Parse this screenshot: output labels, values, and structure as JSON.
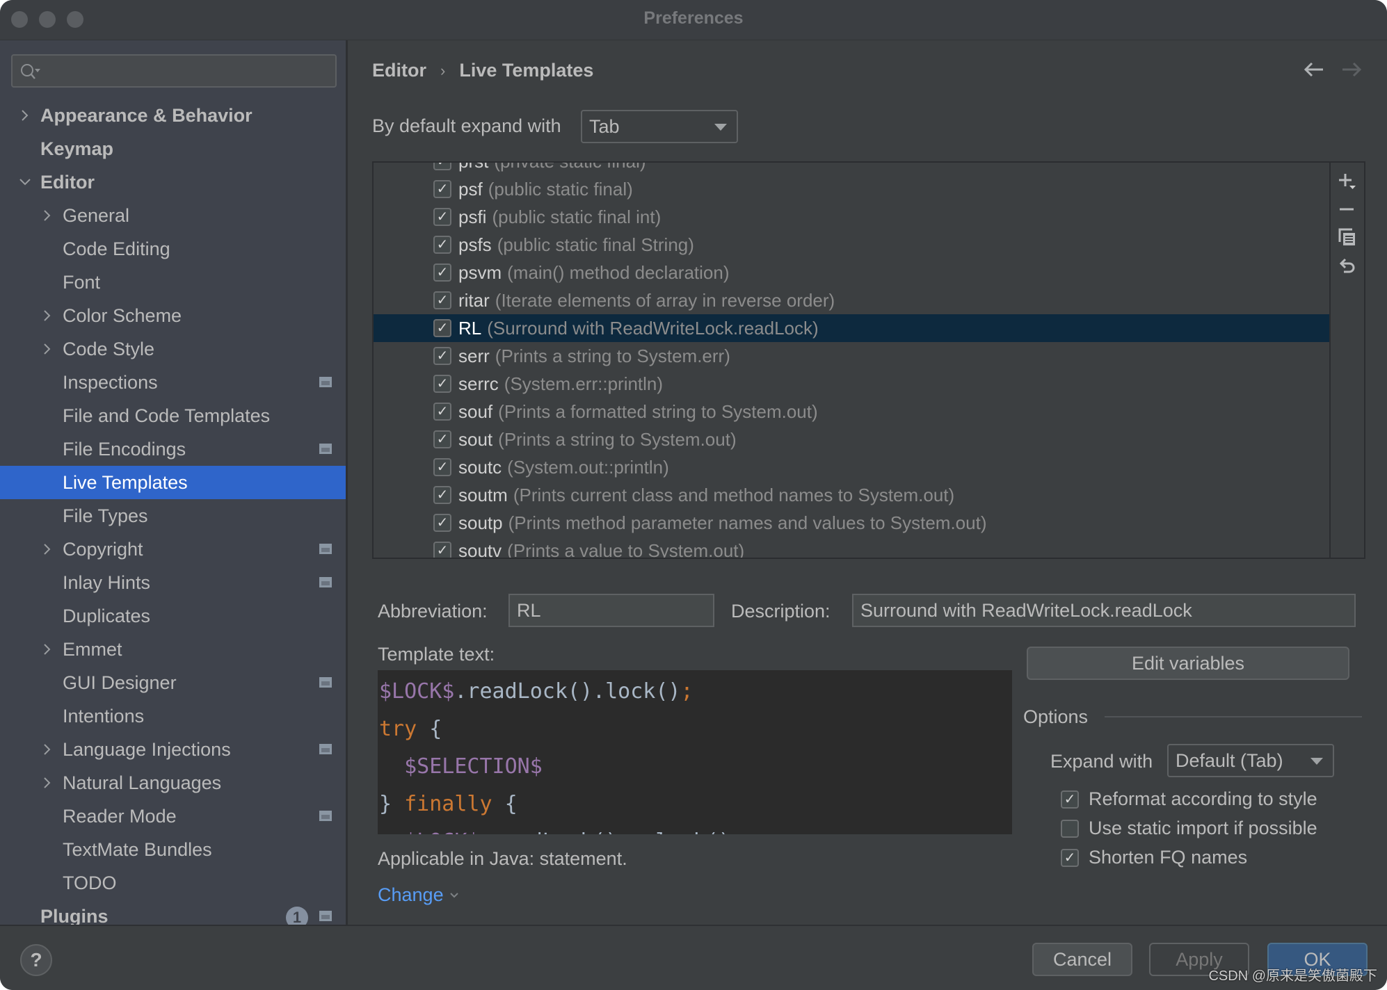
{
  "window": {
    "title": "Preferences"
  },
  "search": {
    "placeholder": "",
    "value": ""
  },
  "sidebar": {
    "items": [
      {
        "label": "Appearance & Behavior",
        "level": 0,
        "arrow": "right",
        "project_icon": false
      },
      {
        "label": "Keymap",
        "level": 0,
        "arrow": "none",
        "project_icon": false
      },
      {
        "label": "Editor",
        "level": 0,
        "arrow": "down",
        "project_icon": false
      },
      {
        "label": "General",
        "level": 1,
        "arrow": "right",
        "project_icon": false
      },
      {
        "label": "Code Editing",
        "level": 1,
        "arrow": "none",
        "project_icon": false
      },
      {
        "label": "Font",
        "level": 1,
        "arrow": "none",
        "project_icon": false
      },
      {
        "label": "Color Scheme",
        "level": 1,
        "arrow": "right",
        "project_icon": false
      },
      {
        "label": "Code Style",
        "level": 1,
        "arrow": "right",
        "project_icon": false
      },
      {
        "label": "Inspections",
        "level": 1,
        "arrow": "none",
        "project_icon": true
      },
      {
        "label": "File and Code Templates",
        "level": 1,
        "arrow": "none",
        "project_icon": false
      },
      {
        "label": "File Encodings",
        "level": 1,
        "arrow": "none",
        "project_icon": true
      },
      {
        "label": "Live Templates",
        "level": 1,
        "arrow": "none",
        "project_icon": false,
        "selected": true
      },
      {
        "label": "File Types",
        "level": 1,
        "arrow": "none",
        "project_icon": false
      },
      {
        "label": "Copyright",
        "level": 1,
        "arrow": "right",
        "project_icon": true
      },
      {
        "label": "Inlay Hints",
        "level": 1,
        "arrow": "none",
        "project_icon": true
      },
      {
        "label": "Duplicates",
        "level": 1,
        "arrow": "none",
        "project_icon": false
      },
      {
        "label": "Emmet",
        "level": 1,
        "arrow": "right",
        "project_icon": false
      },
      {
        "label": "GUI Designer",
        "level": 1,
        "arrow": "none",
        "project_icon": true
      },
      {
        "label": "Intentions",
        "level": 1,
        "arrow": "none",
        "project_icon": false
      },
      {
        "label": "Language Injections",
        "level": 1,
        "arrow": "right",
        "project_icon": true
      },
      {
        "label": "Natural Languages",
        "level": 1,
        "arrow": "right",
        "project_icon": false
      },
      {
        "label": "Reader Mode",
        "level": 1,
        "arrow": "none",
        "project_icon": true
      },
      {
        "label": "TextMate Bundles",
        "level": 1,
        "arrow": "none",
        "project_icon": false
      },
      {
        "label": "TODO",
        "level": 1,
        "arrow": "none",
        "project_icon": false
      },
      {
        "label": "Plugins",
        "level": 0,
        "arrow": "none",
        "project_icon": true,
        "badge": "1"
      }
    ]
  },
  "header": {
    "breadcrumb": [
      "Editor",
      "Live Templates"
    ],
    "separator": "›"
  },
  "expand": {
    "label": "By default expand with",
    "value": "Tab"
  },
  "templates": [
    {
      "abbr": "prst",
      "desc": "(private static final)",
      "checked": true
    },
    {
      "abbr": "psf",
      "desc": "(public static final)",
      "checked": true
    },
    {
      "abbr": "psfi",
      "desc": "(public static final int)",
      "checked": true
    },
    {
      "abbr": "psfs",
      "desc": "(public static final String)",
      "checked": true
    },
    {
      "abbr": "psvm",
      "desc": "(main() method declaration)",
      "checked": true
    },
    {
      "abbr": "ritar",
      "desc": "(Iterate elements of array in reverse order)",
      "checked": true
    },
    {
      "abbr": "RL",
      "desc": "(Surround with ReadWriteLock.readLock)",
      "checked": true,
      "selected": true
    },
    {
      "abbr": "serr",
      "desc": "(Prints a string to System.err)",
      "checked": true
    },
    {
      "abbr": "serrc",
      "desc": "(System.err::println)",
      "checked": true
    },
    {
      "abbr": "souf",
      "desc": "(Prints a formatted string to System.out)",
      "checked": true
    },
    {
      "abbr": "sout",
      "desc": "(Prints a string to System.out)",
      "checked": true
    },
    {
      "abbr": "soutc",
      "desc": "(System.out::println)",
      "checked": true
    },
    {
      "abbr": "soutm",
      "desc": "(Prints current class and method names to System.out)",
      "checked": true
    },
    {
      "abbr": "soutp",
      "desc": "(Prints method parameter names and values to System.out)",
      "checked": true
    },
    {
      "abbr": "soutv",
      "desc": "(Prints a value to System.out)",
      "checked": true
    }
  ],
  "list_toolbar": [
    "add-icon",
    "remove-icon",
    "copy-icon",
    "restore-icon"
  ],
  "editor": {
    "abbreviation_label": "Abbreviation:",
    "abbreviation_value": "RL",
    "description_label": "Description:",
    "description_value": "Surround with ReadWriteLock.readLock",
    "template_text_label": "Template text:",
    "template_lines": [
      [
        {
          "t": "$LOCK$",
          "c": "var"
        },
        {
          "t": ".readLock().lock()",
          "c": "plain"
        },
        {
          "t": ";",
          "c": "kw"
        }
      ],
      [
        {
          "t": "try",
          "c": "kw"
        },
        {
          "t": " {",
          "c": "plain"
        }
      ],
      [
        {
          "t": "  ",
          "c": "plain"
        },
        {
          "t": "$SELECTION$",
          "c": "var"
        }
      ],
      [
        {
          "t": "} ",
          "c": "plain"
        },
        {
          "t": "finally",
          "c": "kw"
        },
        {
          "t": " {",
          "c": "plain"
        }
      ],
      [
        {
          "t": "  ",
          "c": "plain"
        },
        {
          "t": "$LOCK$",
          "c": "var"
        },
        {
          "t": ".readLock().unlock()",
          "c": "plain"
        }
      ]
    ],
    "applicable_text": "Applicable in Java: statement.",
    "change_link": "Change",
    "edit_variables_label": "Edit variables"
  },
  "options": {
    "title": "Options",
    "expand_with_label": "Expand with",
    "expand_with_value": "Default (Tab)",
    "checkboxes": [
      {
        "label": "Reformat according to style",
        "checked": true
      },
      {
        "label": "Use static import if possible",
        "checked": false
      },
      {
        "label": "Shorten FQ names",
        "checked": true
      }
    ]
  },
  "footer": {
    "help": "?",
    "cancel": "Cancel",
    "apply": "Apply",
    "ok": "OK"
  },
  "watermark": "CSDN @原来是笑傲菌殿下",
  "colors": {
    "selection_sidebar": "#2f65ca",
    "selection_list": "#0d293e",
    "link": "#589df6",
    "code_var": "#9876aa",
    "code_keyword": "#cc7832"
  }
}
